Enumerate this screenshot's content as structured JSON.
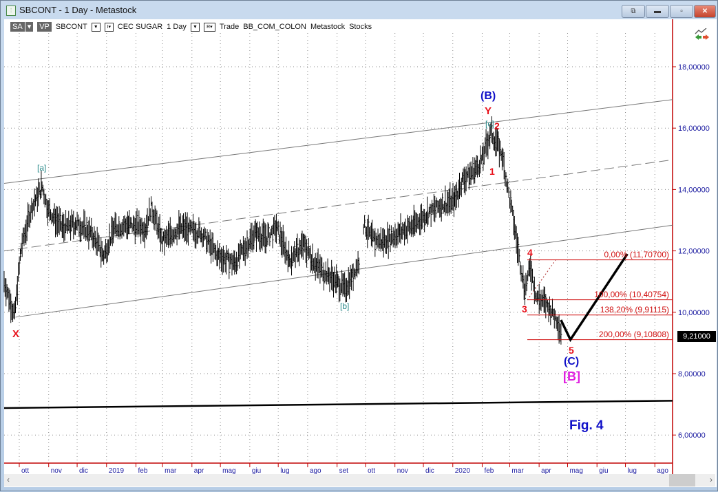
{
  "window": {
    "title": "SBCONT - 1 Day - Metastock",
    "buttons": [
      "restore-window",
      "minimize",
      "maximize",
      "close"
    ]
  },
  "toolbar": {
    "sa": "SA",
    "vp": "VP",
    "symbol": "SBCONT",
    "name": "CEC SUGAR",
    "period": "1 Day",
    "r": "R",
    "mode": "Trade",
    "source": "BB_COM_COLON",
    "provider": "Metastock",
    "type": "Stocks"
  },
  "labels": {
    "B_paren": "(B)",
    "Y": "Y",
    "c": "[c]",
    "w2": "2",
    "w1": "1",
    "a": "[a]",
    "b": "[b]",
    "X": "X",
    "w4": "4",
    "w3": "3",
    "w5": "5",
    "C_paren": "(C)",
    "B_bracket": "[B]",
    "fig": "Fig. 4"
  },
  "fib": [
    {
      "label": "0,00% (11,70700)",
      "value": 11.707
    },
    {
      "label": "100,00% (10,40754)",
      "value": 10.40754
    },
    {
      "label": "138,20% (9,91115)",
      "value": 9.91115
    },
    {
      "label": "200,00% (9,10808)",
      "value": 9.10808
    }
  ],
  "last_price": "9,21000",
  "colors": {
    "wave_red": "#e8101a",
    "wave_blue": "#1010c8",
    "teal": "#2a8a8a",
    "magenta": "#e020e0",
    "axis_red": "#c00000"
  },
  "chart_data": {
    "type": "ohlc",
    "title": "SBCONT - 1 Day",
    "ylim": [
      5,
      19.5
    ],
    "y_ticks": [
      "6,00000",
      "8,00000",
      "10,00000",
      "12,00000",
      "14,00000",
      "16,00000",
      "18,00000"
    ],
    "y_tick_values": [
      6,
      8,
      10,
      12,
      14,
      16,
      18
    ],
    "x_ticks": [
      "ott",
      "nov",
      "dic",
      "2019",
      "feb",
      "mar",
      "apr",
      "mag",
      "giu",
      "lug",
      "ago",
      "set",
      "ott",
      "nov",
      "dic",
      "2020",
      "feb",
      "mar",
      "apr",
      "mag",
      "giu",
      "lug",
      "ago"
    ],
    "x_tick_dates": [
      "2018-10-01",
      "2018-11-01",
      "2018-12-01",
      "2019-01-01",
      "2019-02-01",
      "2019-03-01",
      "2019-04-01",
      "2019-05-01",
      "2019-06-01",
      "2019-07-01",
      "2019-08-01",
      "2019-09-01",
      "2019-10-01",
      "2019-11-01",
      "2019-12-01",
      "2020-01-01",
      "2020-02-01",
      "2020-03-01",
      "2020-04-01",
      "2020-05-01",
      "2020-06-01",
      "2020-07-01",
      "2020-08-01"
    ],
    "close_path": [
      [
        "2018-09-15",
        11.0
      ],
      [
        "2018-09-26",
        9.9
      ],
      [
        "2018-10-03",
        12.1
      ],
      [
        "2018-10-14",
        13.4
      ],
      [
        "2018-10-25",
        14.1
      ],
      [
        "2018-11-01",
        13.3
      ],
      [
        "2018-11-16",
        12.75
      ],
      [
        "2018-11-30",
        12.9
      ],
      [
        "2018-12-15",
        12.6
      ],
      [
        "2018-12-29",
        11.85
      ],
      [
        "2019-01-09",
        12.75
      ],
      [
        "2019-01-24",
        12.85
      ],
      [
        "2019-02-11",
        12.75
      ],
      [
        "2019-02-17",
        13.45
      ],
      [
        "2019-03-01",
        12.3
      ],
      [
        "2019-03-19",
        12.75
      ],
      [
        "2019-04-10",
        12.6
      ],
      [
        "2019-04-28",
        11.85
      ],
      [
        "2019-05-16",
        11.6
      ],
      [
        "2019-06-07",
        12.6
      ],
      [
        "2019-06-18",
        12.4
      ],
      [
        "2019-06-29",
        12.75
      ],
      [
        "2019-07-13",
        11.7
      ],
      [
        "2019-07-28",
        12.2
      ],
      [
        "2019-08-11",
        11.5
      ],
      [
        "2019-09-02",
        10.95
      ],
      [
        "2019-09-09",
        10.75
      ],
      [
        "2019-09-17",
        11.2
      ],
      [
        "2019-09-25",
        11.7
      ],
      [
        "2019-09-29",
        12.85
      ],
      [
        "2019-10-08",
        12.4
      ],
      [
        "2019-10-19",
        12.3
      ],
      [
        "2019-11-06",
        12.6
      ],
      [
        "2019-11-21",
        12.85
      ],
      [
        "2019-12-05",
        13.2
      ],
      [
        "2019-12-20",
        13.5
      ],
      [
        "2020-01-03",
        13.65
      ],
      [
        "2020-01-11",
        14.3
      ],
      [
        "2020-01-25",
        14.65
      ],
      [
        "2020-02-01",
        15.0
      ],
      [
        "2020-02-10",
        15.85
      ],
      [
        "2020-02-16",
        15.55
      ],
      [
        "2020-02-22",
        15.1
      ],
      [
        "2020-02-27",
        14.2
      ],
      [
        "2020-03-05",
        13.0
      ],
      [
        "2020-03-10",
        11.95
      ],
      [
        "2020-03-17",
        10.75
      ],
      [
        "2020-03-23",
        11.5
      ],
      [
        "2020-03-29",
        10.5
      ],
      [
        "2020-04-07",
        10.3
      ],
      [
        "2020-04-14",
        10.05
      ],
      [
        "2020-04-20",
        9.75
      ],
      [
        "2020-04-25",
        9.21
      ]
    ],
    "projection": [
      [
        "2020-04-24",
        9.75
      ],
      [
        "2020-05-04",
        9.108
      ],
      [
        "2020-07-03",
        11.9
      ]
    ],
    "channel_lines": [
      {
        "style": "solid",
        "points": [
          [
            "2018-09-15",
            14.2
          ],
          [
            "2020-08-25",
            16.95
          ]
        ]
      },
      {
        "style": "dashed",
        "points": [
          [
            "2018-09-15",
            12.0
          ],
          [
            "2020-08-25",
            14.99
          ]
        ]
      },
      {
        "style": "solid",
        "points": [
          [
            "2018-09-27",
            9.84
          ],
          [
            "2020-08-25",
            12.86
          ]
        ]
      },
      {
        "style": "thick",
        "points": [
          [
            "2018-09-15",
            6.88
          ],
          [
            "2020-08-25",
            7.12
          ]
        ]
      }
    ],
    "last_value": 9.21
  }
}
